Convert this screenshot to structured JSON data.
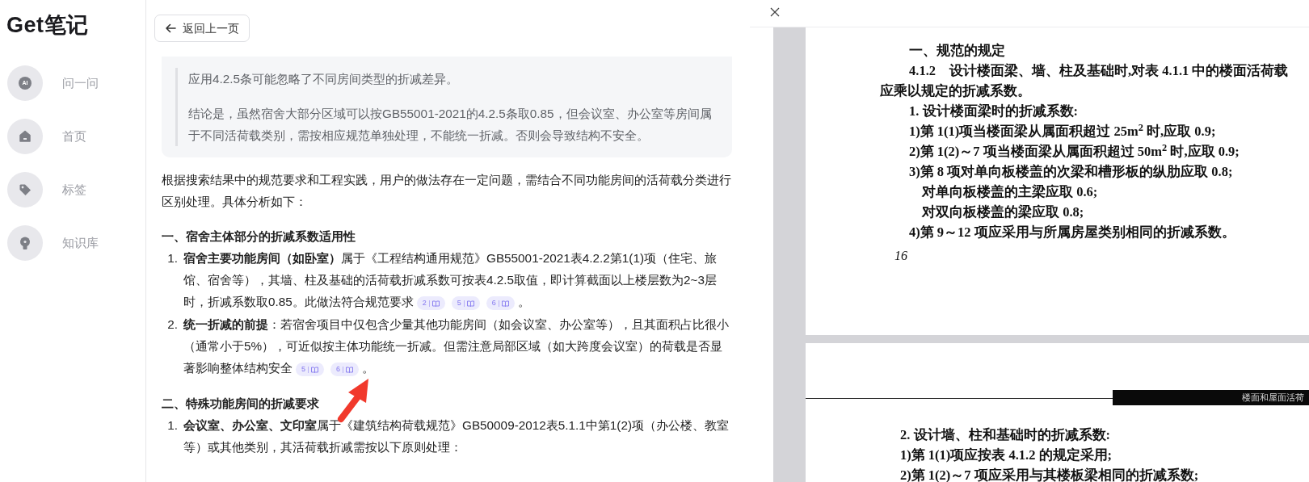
{
  "brand": {
    "text": "Get笔记"
  },
  "sidebar": {
    "items": [
      {
        "label": "问一问",
        "kind": "ai",
        "badge": "AI"
      },
      {
        "label": "首页",
        "kind": "home"
      },
      {
        "label": "标签",
        "kind": "tag"
      },
      {
        "label": "知识库",
        "kind": "bulb"
      }
    ]
  },
  "back_button": {
    "label": "返回上一页"
  },
  "answer": {
    "quote_paragraphs": [
      "应用4.2.5条可能忽略了不同房间类型的折减差异。",
      "结论是，虽然宿舍大部分区域可以按GB55001-2021的4.2.5条取0.85，但会议室、办公室等房间属于不同活荷载类别，需按相应规范单独处理，不能统一折减。否则会导致结构不安全。"
    ],
    "intro": "根据搜索结果中的规范要求和工程实践，用户的做法存在一定问题，需结合不同功能房间的活荷载分类进行区别处理。具体分析如下：",
    "sections": [
      {
        "heading": "一、宿舍主体部分的折减系数适用性",
        "items": [
          {
            "number": "1.",
            "text": "**宿舍主要功能房间（如卧室）**属于《工程结构通用规范》GB55001-2021表4.2.2第1(1)项（住宅、旅馆、宿舍等），其墙、柱及基础的活荷载折减系数可按表4.2.5取值，即计算截面以上楼层数为2~3层时，折减系数取0.85。此做法符合规范要求",
            "citations": [
              "2",
              "5",
              "6"
            ],
            "tail": "。"
          },
          {
            "number": "2.",
            "text": "**统一折减的前提**：若宿舍项目中仅包含少量其他功能房间（如会议室、办公室等），且其面积占比很小（通常小于5%），可近似按主体功能统一折减。但需注意局部区域（如大跨度会议室）的荷载是否显著影响整体结构安全",
            "citations": [
              "5",
              "6"
            ],
            "tail": "。"
          }
        ]
      },
      {
        "heading": "二、特殊功能房间的折减要求",
        "items": [
          {
            "number": "1.",
            "text": "**会议室、办公室、文印室**属于《建筑结构荷载规范》GB50009-2012表5.1.1中第1(2)项（办公楼、教室等）或其他类别，其活荷载折减需按以下原则处理："
          }
        ]
      }
    ]
  },
  "pdf_viewer": {
    "pages": [
      {
        "lines": [
          {
            "kind": "heading",
            "text": "一、规范的规定"
          },
          {
            "kind": "clause",
            "text": "4.1.2　设计楼面梁、墙、柱及基础时,对表 4.1.1 中的楼面活荷载"
          },
          {
            "kind": "continuation",
            "text": "应乘以规定的折减系数。"
          },
          {
            "kind": "item",
            "text": "1. 设计楼面梁时的折减系数:"
          },
          {
            "kind": "item",
            "text": "1)第 1(1)项当楼面梁从属面积超过 25m$^{2}$ 时,应取 0.9;"
          },
          {
            "kind": "item",
            "text": "2)第 1(2)～7 项当楼面梁从属面积超过 50m$^{2}$ 时,应取 0.9;"
          },
          {
            "kind": "item",
            "text": "3)第 8 项对单向板楼盖的次梁和槽形板的纵肋应取 0.8;"
          },
          {
            "kind": "subitem",
            "text": "对单向板楼盖的主梁应取 0.6;"
          },
          {
            "kind": "subitem",
            "text": "对双向板楼盖的梁应取 0.8;"
          },
          {
            "kind": "item",
            "text": "4)第 9～12 项应采用与所属房屋类别相同的折减系数。"
          },
          {
            "kind": "page_number",
            "text": "16"
          }
        ]
      },
      {
        "running_head": "楼面和屋面活荷",
        "lines": [
          {
            "kind": "item",
            "text": "2. 设计墙、柱和基础时的折减系数:"
          },
          {
            "kind": "item",
            "text": "1)第 1(1)项应按表 4.1.2 的规定采用;"
          },
          {
            "kind": "item",
            "text": "2)第 1(2)～7 项应采用与其楼板梁相同的折减系数;"
          }
        ]
      }
    ]
  }
}
